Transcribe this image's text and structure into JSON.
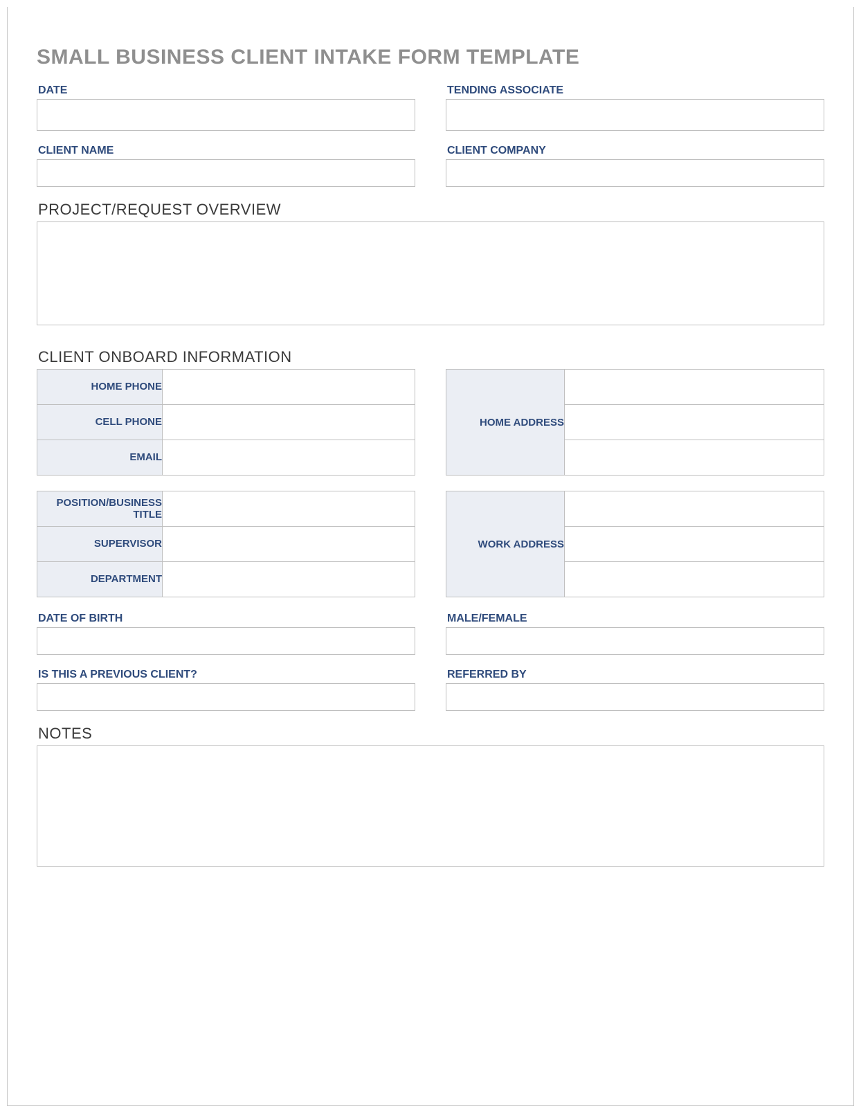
{
  "title": "SMALL BUSINESS CLIENT INTAKE FORM TEMPLATE",
  "top": {
    "date_label": "DATE",
    "date_value": "",
    "associate_label": "TENDING ASSOCIATE",
    "associate_value": "",
    "client_name_label": "CLIENT NAME",
    "client_name_value": "",
    "client_company_label": "CLIENT COMPANY",
    "client_company_value": ""
  },
  "overview": {
    "label": "PROJECT/REQUEST OVERVIEW",
    "value": ""
  },
  "onboard": {
    "section_label": "CLIENT ONBOARD INFORMATION",
    "home_phone_label": "HOME PHONE",
    "home_phone_value": "",
    "cell_phone_label": "CELL PHONE",
    "cell_phone_value": "",
    "email_label": "EMAIL",
    "email_value": "",
    "home_address_label": "HOME ADDRESS",
    "home_address_line1": "",
    "home_address_line2": "",
    "home_address_line3": "",
    "position_label": "POSITION/BUSINESS TITLE",
    "position_value": "",
    "supervisor_label": "SUPERVISOR",
    "supervisor_value": "",
    "department_label": "DEPARTMENT",
    "department_value": "",
    "work_address_label": "WORK ADDRESS",
    "work_address_line1": "",
    "work_address_line2": "",
    "work_address_line3": ""
  },
  "extra": {
    "dob_label": "DATE OF BIRTH",
    "dob_value": "",
    "gender_label": "MALE/FEMALE",
    "gender_value": "",
    "prev_client_label": "IS THIS A PREVIOUS CLIENT?",
    "prev_client_value": "",
    "referred_by_label": "REFERRED BY",
    "referred_by_value": ""
  },
  "notes": {
    "label": "NOTES",
    "value": ""
  }
}
